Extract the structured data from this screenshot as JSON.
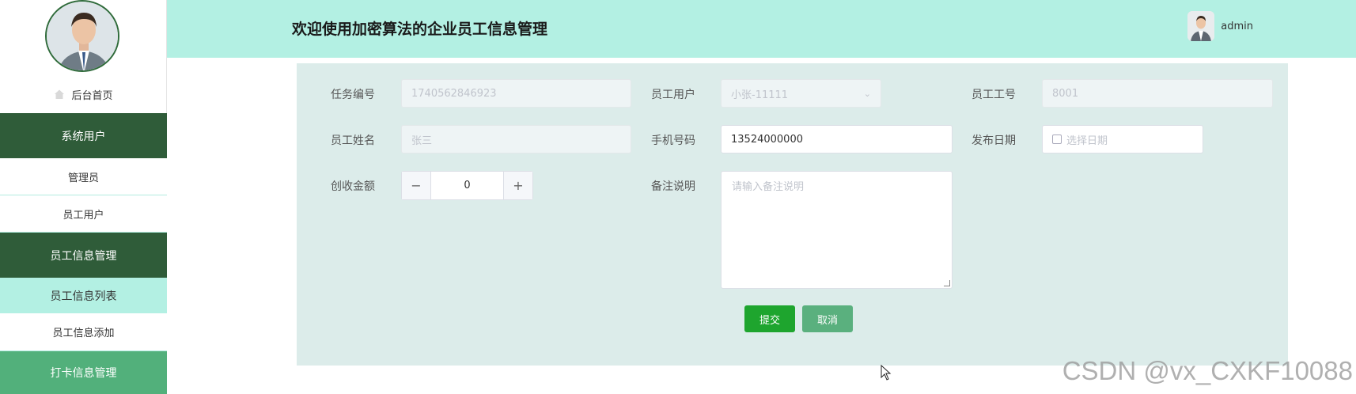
{
  "header": {
    "title": "欢迎使用加密算法的企业员工信息管理",
    "username": "admin"
  },
  "sidebar": {
    "home": "后台首页",
    "items": [
      {
        "label": "系统用户",
        "kind": "group"
      },
      {
        "label": "管理员",
        "kind": "sub"
      },
      {
        "label": "员工用户",
        "kind": "sub"
      },
      {
        "label": "员工信息管理",
        "kind": "group"
      },
      {
        "label": "员工信息列表",
        "kind": "active"
      },
      {
        "label": "员工信息添加",
        "kind": "sub"
      },
      {
        "label": "打卡信息管理",
        "kind": "group-light"
      }
    ]
  },
  "form": {
    "task_no": {
      "label": "任务编号",
      "value": "1740562846923"
    },
    "employee_user": {
      "label": "员工用户",
      "value": "小张-11111"
    },
    "employee_no": {
      "label": "员工工号",
      "value": "8001"
    },
    "employee_name": {
      "label": "员工姓名",
      "value": "张三"
    },
    "phone": {
      "label": "手机号码",
      "value": "13524000000"
    },
    "publish_date": {
      "label": "发布日期",
      "placeholder": "选择日期"
    },
    "revenue": {
      "label": "创收金额",
      "value": "0",
      "minus": "−",
      "plus": "+"
    },
    "remark": {
      "label": "备注说明",
      "placeholder": "请输入备注说明"
    },
    "submit": "提交",
    "cancel": "取消"
  },
  "watermark": "CSDN @vx_CXKF10088",
  "colors": {
    "header_bg": "#b3f0e3",
    "sidebar_group": "#2f5c39",
    "sidebar_active": "#b3f0e3",
    "sidebar_group_light": "#52b07b",
    "panel_bg": "#dcecea",
    "submit": "#1ea52e",
    "cancel": "#5ab07e"
  }
}
